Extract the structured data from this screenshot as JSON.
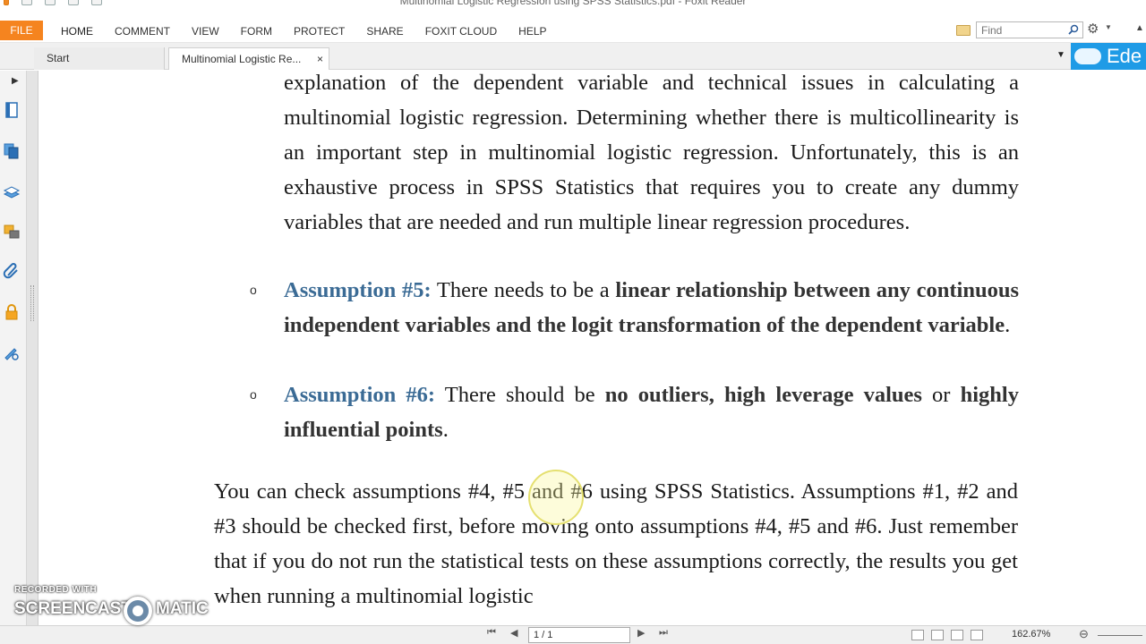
{
  "window": {
    "title": "Multinomial Logistic Regression using SPSS Statistics.pdf - Foxit Reader"
  },
  "menu": {
    "file": "FILE",
    "items": [
      "HOME",
      "COMMENT",
      "VIEW",
      "FORM",
      "PROTECT",
      "SHARE",
      "FOXIT CLOUD",
      "HELP"
    ]
  },
  "search": {
    "placeholder": "Find"
  },
  "tabs": [
    {
      "label": "Start"
    },
    {
      "label": "Multinomial Logistic Re...",
      "close": "×"
    }
  ],
  "cloud_button": {
    "label": "Ede"
  },
  "document": {
    "para1": "explanation of the dependent variable and technical issues in calculating a multinomial logistic regression. Determining whether there is multicollinearity is an important step in multinomial logistic regression. Unfortunately, this is an exhaustive process in SPSS Statistics that requires you to create any dummy variables that are needed and run multiple linear regression procedures.",
    "bullet_mark": "o",
    "assumption5": {
      "label": "Assumption #5:",
      "text1": " There needs to be a ",
      "bold": "linear relationship between any continuous independent variables and the logit transformation of the dependent variable",
      "end": "."
    },
    "assumption6": {
      "label": "Assumption #6:",
      "text1": " There should be ",
      "bold1": "no outliers, high leverage values",
      "text2": " or ",
      "bold2": "highly influential points",
      "end": "."
    },
    "para2": "You can check assumptions #4, #5 and #6 using SPSS Statistics. Assumptions #1, #2 and #3 should be checked first, before moving onto assumptions #4, #5 and #6. Just remember that if you do not run the statistical tests on these assumptions correctly, the results you get when running a multinomial logistic"
  },
  "statusbar": {
    "page": "1 / 1",
    "zoom": "162.67%"
  },
  "watermark": {
    "line1": "RECORDED WITH",
    "line2a": "SCREENCAST",
    "line2b": "MATIC"
  },
  "colors": {
    "file_tab": "#f5841f",
    "assumption_label": "#3b6b95",
    "cloud_button": "#1f9be6"
  }
}
